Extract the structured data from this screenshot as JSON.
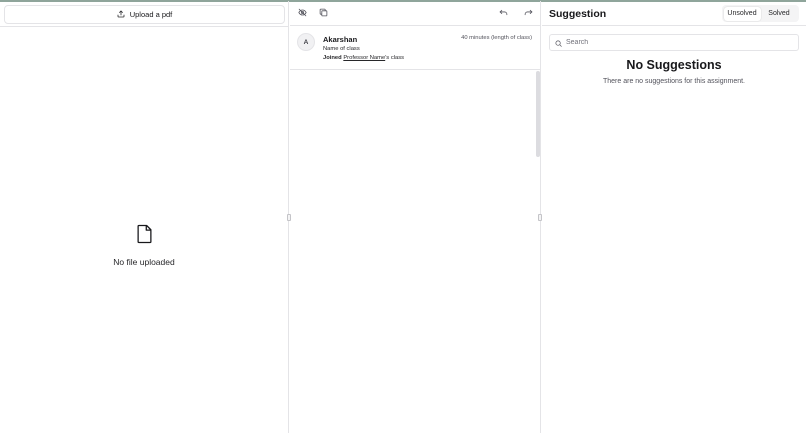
{
  "left_panel": {
    "upload_label": "Upload a pdf",
    "empty_text": "No file uploaded"
  },
  "middle_panel": {
    "toolbar_icons": [
      "eye-off-icon",
      "copy-icon",
      "undo-icon",
      "redo-icon"
    ],
    "message": {
      "avatar_initial": "A",
      "author": "Akarshan",
      "time": "40 minutes (length of class)",
      "class_name": "Name of class",
      "joined_prefix": "Joined",
      "professor_link": "Professor Name",
      "joined_suffix": "'s class"
    }
  },
  "right_panel": {
    "title": "Suggestion",
    "tabs": [
      "Unsolved",
      "Solved"
    ],
    "active_tab": "Unsolved",
    "search_placeholder": "Search",
    "empty_title": "No Suggestions",
    "empty_subtitle": "There are no suggestions for this assignment."
  },
  "colors": {
    "border": "#e4e4e7",
    "top_accent": "#8fa59b",
    "muted_text": "#52525b"
  }
}
